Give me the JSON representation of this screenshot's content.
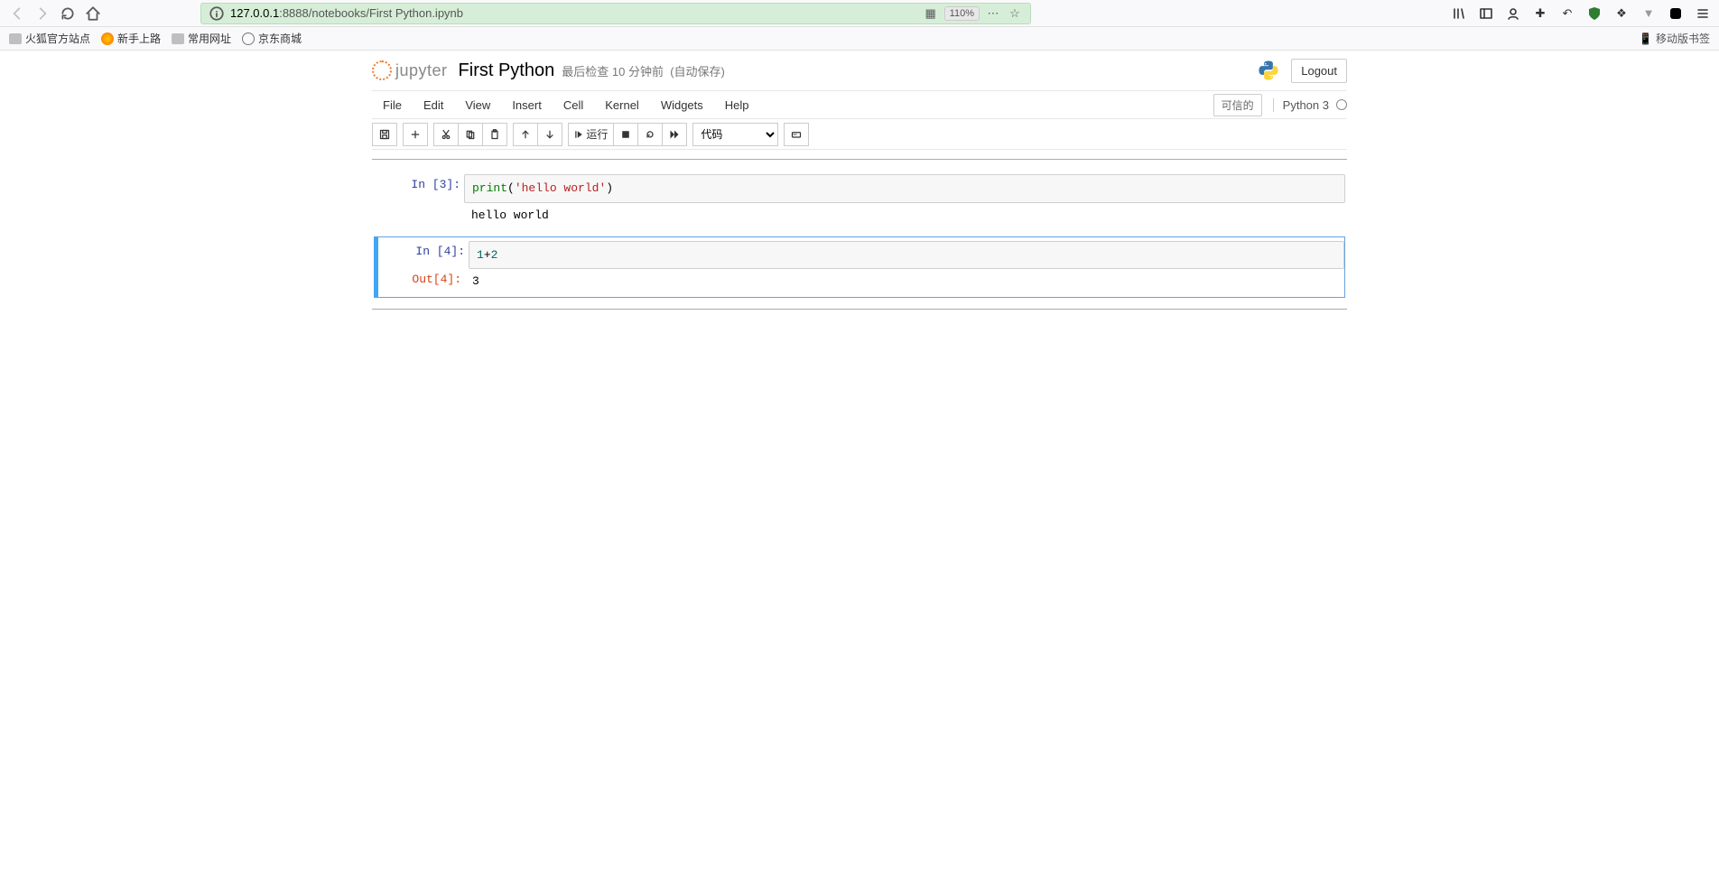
{
  "browser": {
    "url_host": "127.0.0.1",
    "url_rest": ":8888/notebooks/First Python.ipynb",
    "zoom": "110%",
    "bookmarks": [
      "火狐官方站点",
      "新手上路",
      "常用网址",
      "京东商城"
    ],
    "mobile_label": "移动版书签"
  },
  "header": {
    "logo_text": "jupyter",
    "notebook_name": "First Python",
    "checkpoint_label": "最后检查",
    "checkpoint_time": "10 分钟前",
    "autosave": "(自动保存)",
    "logout": "Logout"
  },
  "menu": {
    "items": [
      "File",
      "Edit",
      "View",
      "Insert",
      "Cell",
      "Kernel",
      "Widgets",
      "Help"
    ],
    "trusted": "可信的",
    "kernel": "Python 3"
  },
  "toolbar": {
    "run_label": "运行",
    "cell_type": "代码"
  },
  "cells": [
    {
      "in_prompt": "In  [3]:",
      "code_call": "print",
      "code_open": "(",
      "code_str": "'hello world'",
      "code_close": ")",
      "stdout": "hello world"
    },
    {
      "in_prompt": "In  [4]:",
      "code_plain1": "1",
      "code_op": "+",
      "code_plain2": "2",
      "out_prompt": "Out[4]:",
      "out_value": "3"
    }
  ]
}
